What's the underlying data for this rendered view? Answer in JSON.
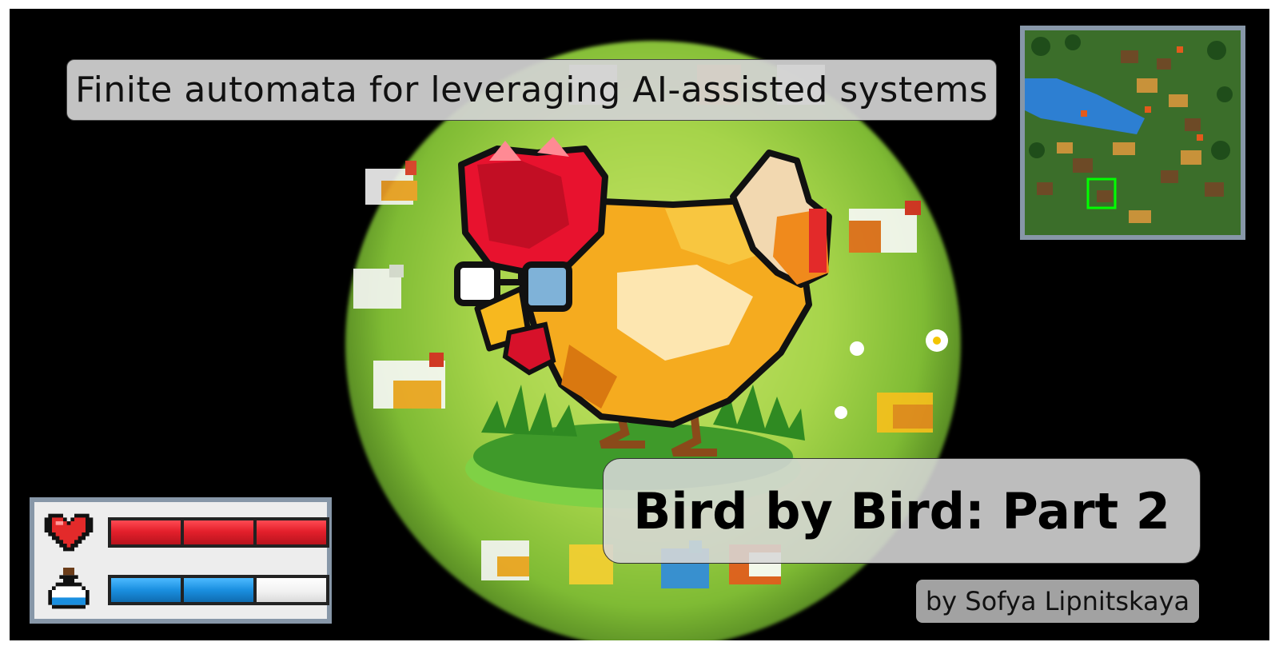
{
  "slide": {
    "subtitle": "Finite automata for leveraging AI-assisted systems",
    "title": "Bird by Bird: Part 2",
    "author": "by Sofya Lipnitskaya"
  },
  "hud": {
    "health_segments_filled": 3,
    "health_segments_total": 3,
    "mana_segments_filled": 2,
    "mana_segments_total": 3,
    "health_icon": "heart-icon",
    "mana_icon": "potion-icon",
    "health_color": "#e4202c",
    "mana_color": "#1a8fe0"
  },
  "minimap": {
    "viewport_marker_color": "#00ff00",
    "frame_color": "#8797a8"
  }
}
